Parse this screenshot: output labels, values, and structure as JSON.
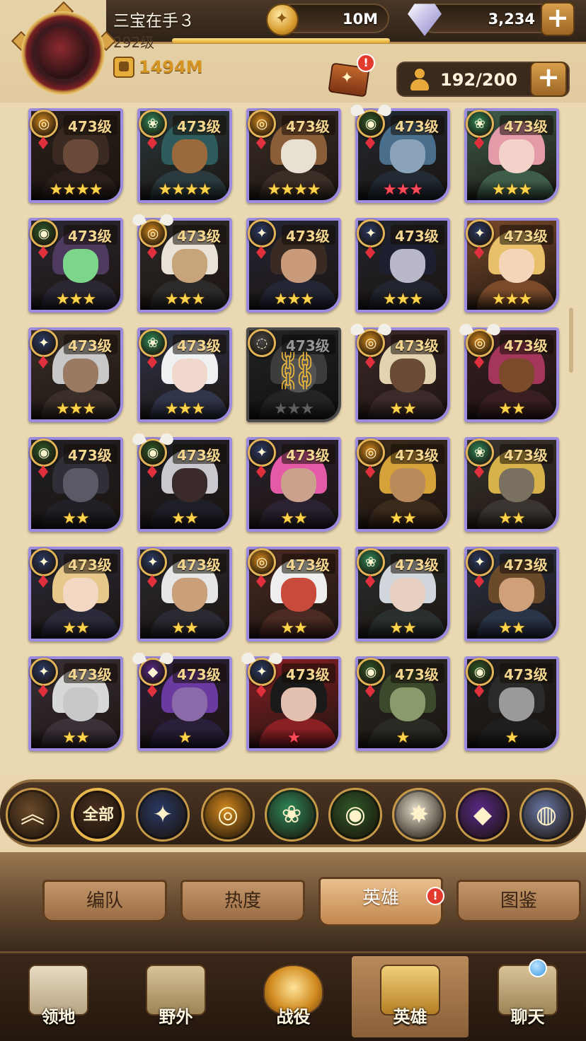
{
  "player": {
    "name": "三宝在手３",
    "level": "292级",
    "xp_progress": 1.0,
    "power": "1494M"
  },
  "currencies": {
    "gold": "10M",
    "gems": "3,234"
  },
  "roster": {
    "capacity": "192/200",
    "formation_alert": "!"
  },
  "colors": {
    "card_border": "#9d8be0",
    "star_gold": "#ffd34a",
    "star_red": "#ff4a5a",
    "accent_gold": "#d69624"
  },
  "heroes": [
    {
      "level": "473级",
      "faction": "lightbearer",
      "stars": 4,
      "star_color": "gold",
      "wings": false,
      "locked": false,
      "palette": [
        "#3a2a22",
        "#6b4a3a",
        "#2a1f1b"
      ]
    },
    {
      "level": "473级",
      "faction": "wilder",
      "stars": 4,
      "star_color": "gold",
      "wings": false,
      "locked": false,
      "palette": [
        "#2e5b5c",
        "#9b6a3c",
        "#2a3a3e"
      ]
    },
    {
      "level": "473级",
      "faction": "lightbearer",
      "stars": 4,
      "star_color": "gold",
      "wings": false,
      "locked": false,
      "palette": [
        "#8b5e3a",
        "#e8e1d3",
        "#3b2e26"
      ]
    },
    {
      "level": "473级",
      "faction": "graveborn",
      "stars": 3,
      "star_color": "red",
      "wings": true,
      "locked": false,
      "palette": [
        "#4a6f8c",
        "#8aa3b8",
        "#222a33"
      ]
    },
    {
      "level": "473级",
      "faction": "wilder",
      "stars": 3,
      "star_color": "gold",
      "wings": false,
      "locked": false,
      "palette": [
        "#e59aa8",
        "#f3d2c9",
        "#3e5e4a"
      ]
    },
    {
      "level": "473级",
      "faction": "graveborn",
      "stars": 3,
      "star_color": "gold",
      "wings": false,
      "locked": false,
      "palette": [
        "#4d3a5e",
        "#7cd68a",
        "#2a2733"
      ]
    },
    {
      "level": "473级",
      "faction": "lightbearer",
      "stars": 3,
      "star_color": "gold",
      "wings": true,
      "locked": false,
      "palette": [
        "#e8e3d6",
        "#c7a47a",
        "#2d2a2a"
      ]
    },
    {
      "level": "473级",
      "faction": "mauler",
      "stars": 3,
      "star_color": "gold",
      "wings": false,
      "locked": false,
      "palette": [
        "#3a2a24",
        "#c99b7a",
        "#242636"
      ]
    },
    {
      "level": "473级",
      "faction": "mauler",
      "stars": 3,
      "star_color": "gold",
      "wings": false,
      "locked": false,
      "palette": [
        "#1e2030",
        "#b8b8c8",
        "#22252f"
      ]
    },
    {
      "level": "473级",
      "faction": "mauler",
      "stars": 3,
      "star_color": "gold",
      "wings": false,
      "locked": false,
      "palette": [
        "#e8c06a",
        "#f4d5b8",
        "#7a4a2a"
      ]
    },
    {
      "level": "473级",
      "faction": "mauler",
      "stars": 3,
      "star_color": "gold",
      "wings": false,
      "locked": false,
      "palette": [
        "#c8c8c8",
        "#9a7a62",
        "#3a2f28"
      ]
    },
    {
      "level": "473级",
      "faction": "wilder",
      "stars": 3,
      "star_color": "gold",
      "wings": false,
      "locked": false,
      "palette": [
        "#eef0f2",
        "#f0d8cc",
        "#30354a"
      ]
    },
    {
      "level": "473级",
      "faction": "locked",
      "stars": 3,
      "star_color": "grey",
      "wings": false,
      "locked": true,
      "palette": [
        "#555555",
        "#777777",
        "#333333"
      ]
    },
    {
      "level": "473级",
      "faction": "lightbearer",
      "stars": 2,
      "star_color": "gold",
      "wings": true,
      "locked": false,
      "palette": [
        "#e3d3b0",
        "#6b4a36",
        "#3d2a2a"
      ]
    },
    {
      "level": "473级",
      "faction": "lightbearer",
      "stars": 2,
      "star_color": "gold",
      "wings": true,
      "locked": false,
      "palette": [
        "#a3365a",
        "#7a4a2a",
        "#3a1f22"
      ]
    },
    {
      "level": "473级",
      "faction": "graveborn",
      "stars": 2,
      "star_color": "gold",
      "wings": false,
      "locked": false,
      "palette": [
        "#2f2f38",
        "#5a5a66",
        "#202026"
      ]
    },
    {
      "level": "473级",
      "faction": "graveborn",
      "stars": 2,
      "star_color": "gold",
      "wings": true,
      "locked": false,
      "palette": [
        "#c9c9cf",
        "#3a2a2a",
        "#1f1f28"
      ]
    },
    {
      "level": "473级",
      "faction": "mauler",
      "stars": 2,
      "star_color": "gold",
      "wings": false,
      "locked": false,
      "palette": [
        "#e55aa6",
        "#c9a18c",
        "#2a2230"
      ]
    },
    {
      "level": "473级",
      "faction": "lightbearer",
      "stars": 2,
      "star_color": "gold",
      "wings": false,
      "locked": false,
      "palette": [
        "#d6a23a",
        "#b98a5a",
        "#3a2a1c"
      ]
    },
    {
      "level": "473级",
      "faction": "wilder",
      "stars": 2,
      "star_color": "gold",
      "wings": false,
      "locked": false,
      "palette": [
        "#d7b24a",
        "#7a7060",
        "#3a3530"
      ]
    },
    {
      "level": "473级",
      "faction": "mauler",
      "stars": 2,
      "star_color": "gold",
      "wings": false,
      "locked": false,
      "palette": [
        "#e8c88a",
        "#f2d7c3",
        "#2a2a3a"
      ]
    },
    {
      "level": "473级",
      "faction": "mauler",
      "stars": 2,
      "star_color": "gold",
      "wings": false,
      "locked": false,
      "palette": [
        "#e6e6e6",
        "#c9a07a",
        "#2a2a32"
      ]
    },
    {
      "level": "473级",
      "faction": "lightbearer",
      "stars": 2,
      "star_color": "gold",
      "wings": false,
      "locked": false,
      "palette": [
        "#eeeeee",
        "#c84a3a",
        "#4a2a22"
      ]
    },
    {
      "level": "473级",
      "faction": "wilder",
      "stars": 2,
      "star_color": "gold",
      "wings": false,
      "locked": false,
      "palette": [
        "#d0d6dc",
        "#e8d0c2",
        "#2a3030"
      ]
    },
    {
      "level": "473级",
      "faction": "mauler",
      "stars": 2,
      "star_color": "gold",
      "wings": false,
      "locked": false,
      "palette": [
        "#6b4a2a",
        "#d0a07a",
        "#2a3448"
      ]
    },
    {
      "level": "473级",
      "faction": "mauler",
      "stars": 2,
      "star_color": "gold",
      "wings": false,
      "locked": false,
      "palette": [
        "#d8d8d8",
        "#c8c8c8",
        "#3a3038"
      ]
    },
    {
      "level": "473级",
      "faction": "hypogean",
      "stars": 1,
      "star_color": "gold",
      "wings": true,
      "locked": false,
      "palette": [
        "#6a3aa0",
        "#8a6aa8",
        "#2a1f3a"
      ]
    },
    {
      "level": "473级",
      "faction": "mauler",
      "stars": 1,
      "star_color": "red",
      "wings": true,
      "locked": false,
      "palette": [
        "#1a1a1a",
        "#e3c0b0",
        "#8a1f24"
      ]
    },
    {
      "level": "473级",
      "faction": "graveborn",
      "stars": 1,
      "star_color": "gold",
      "wings": false,
      "locked": false,
      "palette": [
        "#3a4a2a",
        "#8a9a6a",
        "#2a2a24"
      ]
    },
    {
      "level": "473级",
      "faction": "graveborn",
      "stars": 1,
      "star_color": "gold",
      "wings": false,
      "locked": false,
      "palette": [
        "#2a2a2a",
        "#9a9a9a",
        "#1f1f1f"
      ]
    }
  ],
  "faction_icons": {
    "lightbearer": {
      "color": "#d58a1e",
      "glyph": "◎"
    },
    "wilder": {
      "color": "#2f8a5a",
      "glyph": "❀"
    },
    "graveborn": {
      "color": "#2f5a2a",
      "glyph": "◉"
    },
    "mauler": {
      "color": "#2a3a66",
      "glyph": "✦"
    },
    "hypogean": {
      "color": "#5a2a8a",
      "glyph": "◆"
    },
    "locked": {
      "color": "#4a4a4a",
      "glyph": "◌"
    }
  },
  "filters": [
    {
      "name": "collapse",
      "glyph": "︽",
      "color": "#6b4a2a"
    },
    {
      "name": "all",
      "label": "全部",
      "color": "#4a3020"
    },
    {
      "name": "mauler",
      "glyph": "✦",
      "color": "#2a3a66"
    },
    {
      "name": "lightbearer",
      "glyph": "◎",
      "color": "#d58a1e"
    },
    {
      "name": "wilder",
      "glyph": "❀",
      "color": "#2f8a5a"
    },
    {
      "name": "graveborn",
      "glyph": "◉",
      "color": "#2f5a2a"
    },
    {
      "name": "celestial",
      "glyph": "✸",
      "color": "#e8e2d0"
    },
    {
      "name": "hypogean",
      "glyph": "◆",
      "color": "#5a2a8a"
    },
    {
      "name": "dimensional",
      "glyph": "◍",
      "color": "#6a7aa8"
    }
  ],
  "subtabs": [
    {
      "label": "编队",
      "active": false
    },
    {
      "label": "热度",
      "active": false
    },
    {
      "label": "英雄",
      "active": true,
      "alert": "!"
    },
    {
      "label": "图鉴",
      "active": false
    }
  ],
  "nav": [
    {
      "label": "领地",
      "icon": "castle-icon",
      "active": false
    },
    {
      "label": "野外",
      "icon": "map-scroll-icon",
      "active": false
    },
    {
      "label": "战役",
      "icon": "sword-shield-icon",
      "active": false
    },
    {
      "label": "英雄",
      "icon": "helmet-icon",
      "active": true
    },
    {
      "label": "聊天",
      "icon": "chat-bubble-icon",
      "active": false
    }
  ]
}
